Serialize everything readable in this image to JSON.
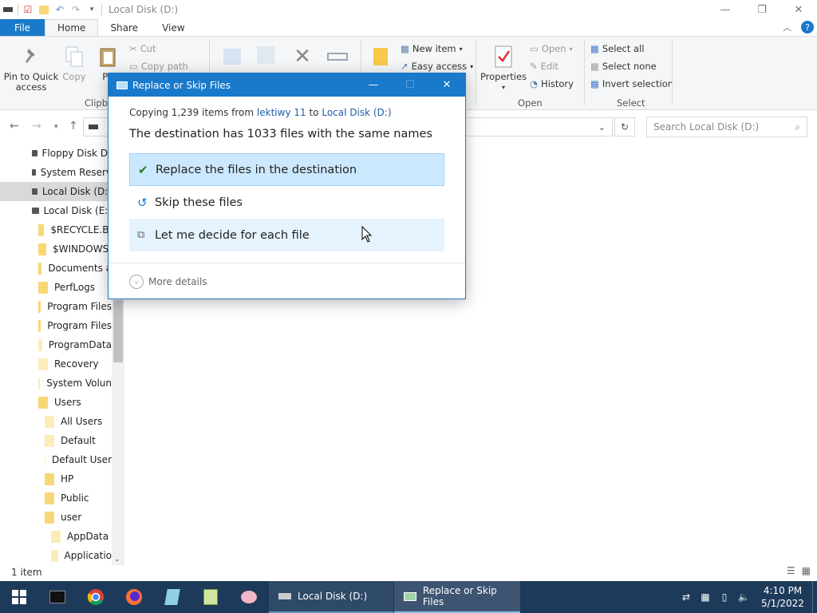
{
  "window": {
    "title": "Local Disk (D:)"
  },
  "tabs": {
    "file": "File",
    "home": "Home",
    "share": "Share",
    "view": "View"
  },
  "ribbon": {
    "pin": "Pin to Quick access",
    "copy": "Copy",
    "paste": "Pa",
    "cut": "Cut",
    "copy_path": "Copy path",
    "clipboard_label": "Clipbo",
    "new_item": "New item",
    "easy_access": "Easy access",
    "properties": "Properties",
    "open": "Open",
    "edit": "Edit",
    "history": "History",
    "open_group": "Open",
    "select_all": "Select all",
    "select_none": "Select none",
    "invert_selection": "Invert selection",
    "select_group": "Select"
  },
  "search": {
    "placeholder": "Search Local Disk (D:)"
  },
  "nav": {
    "items": [
      {
        "label": "Floppy Disk Dr",
        "type": "drive"
      },
      {
        "label": "System Reserv",
        "type": "drive"
      },
      {
        "label": "Local Disk (D:)",
        "type": "drive",
        "selected": true
      },
      {
        "label": "Local Disk (E:)",
        "type": "drive"
      },
      {
        "label": "$RECYCLE.BI",
        "type": "folder"
      },
      {
        "label": "$WINDOWS.",
        "type": "folder"
      },
      {
        "label": "Documents a",
        "type": "folder"
      },
      {
        "label": "PerfLogs",
        "type": "folder"
      },
      {
        "label": "Program Files",
        "type": "folder"
      },
      {
        "label": "Program Files",
        "type": "folder"
      },
      {
        "label": "ProgramData",
        "type": "folder-light"
      },
      {
        "label": "Recovery",
        "type": "folder-light"
      },
      {
        "label": "System Volun",
        "type": "folder-light"
      },
      {
        "label": "Users",
        "type": "folder"
      },
      {
        "label": "All Users",
        "type": "folder-light"
      },
      {
        "label": "Default",
        "type": "folder-light"
      },
      {
        "label": "Default User",
        "type": "folder-light"
      },
      {
        "label": "HP",
        "type": "folder"
      },
      {
        "label": "Public",
        "type": "folder"
      },
      {
        "label": "user",
        "type": "folder"
      },
      {
        "label": "AppData",
        "type": "folder-light"
      },
      {
        "label": "Applicatio",
        "type": "folder-light"
      }
    ]
  },
  "status": {
    "items": "1 item"
  },
  "dialog": {
    "title": "Replace or Skip Files",
    "copying_prefix": "Copying 1,239 items from",
    "source": "lektiwy 11",
    "to_word": "to",
    "destination": "Local Disk (D:)",
    "headline": "The destination has 1033 files with the same names",
    "option_replace": "Replace the files in the destination",
    "option_skip": "Skip these files",
    "option_decide": "Let me decide for each file",
    "more_details": "More details"
  },
  "taskbar": {
    "app1": "Local Disk (D:)",
    "app2": "Replace or Skip Files",
    "time": "4:10 PM",
    "date": "5/1/2022"
  },
  "colors": {
    "accent": "#1979ca",
    "selected_option": "#cce8ff",
    "hover_option": "#e5f3ff",
    "taskbar": "#1e3a5a"
  }
}
